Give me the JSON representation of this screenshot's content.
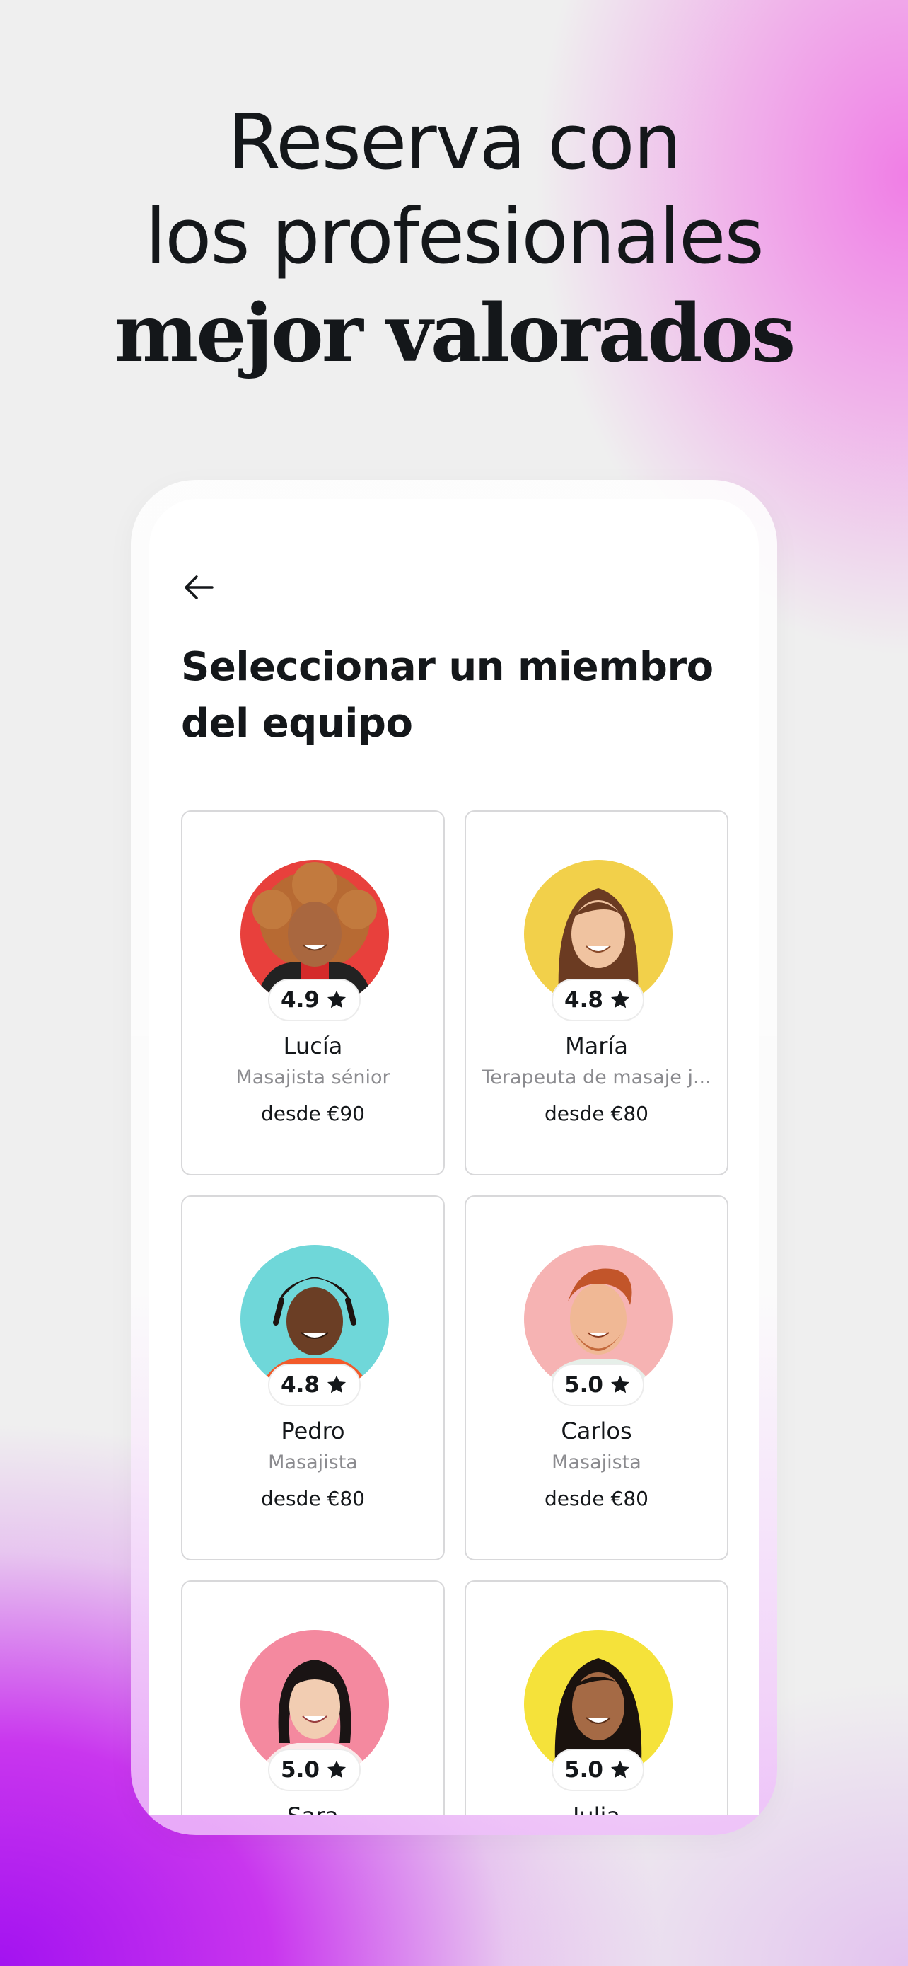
{
  "headline": {
    "line1": "Reserva con",
    "line2": "los profesionales",
    "line3": "mejor valorados"
  },
  "screen": {
    "back_icon": "arrow-left-icon",
    "title": "Seleccionar un miembro del equipo"
  },
  "team": [
    {
      "name": "Lucía",
      "role": "Masajista sénior",
      "price": "desde €90",
      "rating": "4.9",
      "avatar_bg": "#e8403c"
    },
    {
      "name": "María",
      "role": "Terapeuta de masaje j...",
      "price": "desde €80",
      "rating": "4.8",
      "avatar_bg": "#f2d04a"
    },
    {
      "name": "Pedro",
      "role": "Masajista",
      "price": "desde €80",
      "rating": "4.8",
      "avatar_bg": "#6fd7d9"
    },
    {
      "name": "Carlos",
      "role": "Masajista",
      "price": "desde €80",
      "rating": "5.0",
      "avatar_bg": "#f6b3b3"
    },
    {
      "name": "Sara",
      "role": "",
      "price": "",
      "rating": "5.0",
      "avatar_bg": "#f4899f"
    },
    {
      "name": "Julia",
      "role": "",
      "price": "",
      "rating": "5.0",
      "avatar_bg": "#f5e23a"
    }
  ],
  "colors": {
    "text": "#14171a",
    "muted": "#8b8b8f",
    "pink_accent": "#f07ee6",
    "purple_accent": "#a312f0"
  }
}
